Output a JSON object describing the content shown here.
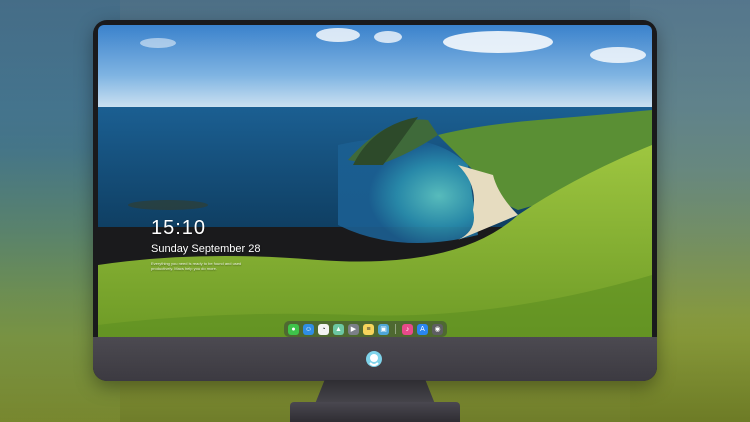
{
  "lock_screen": {
    "time": "15:10",
    "date": "Sunday September 28",
    "notice": "Everything you need is ready to be found and used productively. Macs help you do more."
  },
  "dock": {
    "items": [
      {
        "name": "messages-app-icon",
        "color": "#3ec34a",
        "glyph": "●"
      },
      {
        "name": "finder-app-icon",
        "color": "#2f8de4",
        "glyph": "☺"
      },
      {
        "name": "clock-app-icon",
        "color": "#f2f2f2",
        "glyph": "◔"
      },
      {
        "name": "maps-app-icon",
        "color": "#6cc7a2",
        "glyph": "▲"
      },
      {
        "name": "video-editor-app-icon",
        "color": "#7b7f88",
        "glyph": "▶"
      },
      {
        "name": "notes-app-icon",
        "color": "#f6d55c",
        "glyph": "≡"
      },
      {
        "name": "photos-app-icon",
        "color": "#4ea6d8",
        "glyph": "▣"
      },
      {
        "name": "music-app-icon",
        "color": "#e84a8a",
        "glyph": "♪"
      },
      {
        "name": "app-store-app-icon",
        "color": "#2a86f0",
        "glyph": "A"
      },
      {
        "name": "camera-app-icon",
        "color": "#5e5e62",
        "glyph": "◉"
      }
    ]
  },
  "colors": {
    "bezel": "#1a1a1c",
    "chin": "#45434a",
    "sky": "#4b8fd3",
    "sea": "#1d6f9f",
    "grass": "#8fb83a"
  }
}
